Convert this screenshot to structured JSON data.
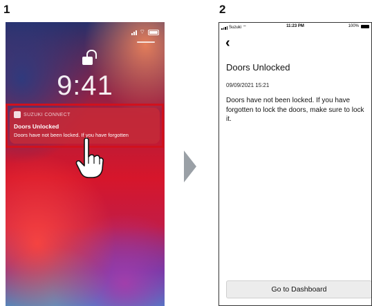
{
  "steps": {
    "first": "1",
    "second": "2"
  },
  "lock_screen": {
    "time": "9:41",
    "notification": {
      "app_name": "SUZUKI CONNECT",
      "title": "Doors Unlocked",
      "body": "Doors have not been locked. If you have forgotten"
    },
    "highlight_color": "#d0111d"
  },
  "app_screen": {
    "status_bar": {
      "carrier": "Suzuki",
      "time": "11:23 PM",
      "battery": "100%"
    },
    "back_icon": "chevron-left-icon",
    "title": "Doors Unlocked",
    "date": "09/09/2021 15:21",
    "message": "Doors have not been locked. If you have forgotten to lock the doors, make sure to lock it.",
    "dashboard_button": "Go to Dashboard"
  },
  "arrow_color": "#9aa0a6"
}
